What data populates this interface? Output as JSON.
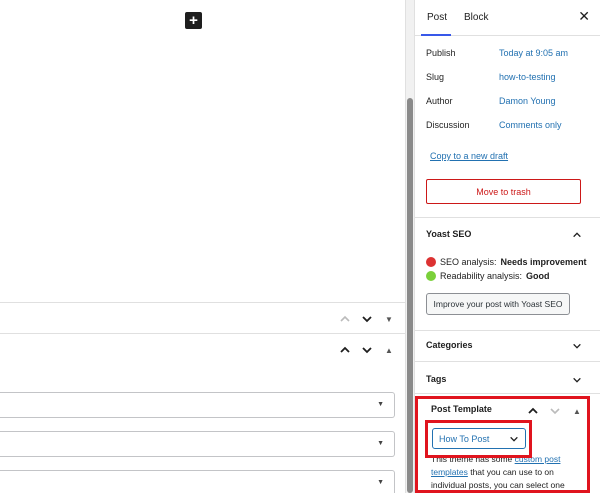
{
  "editor": {
    "add_block_symbol": "+"
  },
  "sidebar": {
    "tabs": [
      {
        "label": "Post",
        "active": true
      },
      {
        "label": "Block",
        "active": false
      }
    ],
    "close_symbol": "✕",
    "fields": [
      {
        "label": "Publish",
        "value": "Today at 9:05 am"
      },
      {
        "label": "Slug",
        "value": "how-to-testing"
      },
      {
        "label": "Author",
        "value": "Damon Young"
      },
      {
        "label": "Discussion",
        "value": "Comments only"
      }
    ],
    "copy_link": "Copy to a new draft",
    "trash_label": "Move to trash",
    "yoast": {
      "title": "Yoast SEO",
      "seo_label": "SEO analysis:",
      "seo_value": "Needs improvement",
      "read_label": "Readability analysis:",
      "read_value": "Good",
      "button": "Improve your post with Yoast SEO"
    },
    "categories_title": "Categories",
    "tags_title": "Tags",
    "post_template": {
      "title": "Post Template",
      "selected": "How To Post",
      "desc_pre": "This theme has some ",
      "desc_link": "custom post templates",
      "desc_post": " that you can use to on individual posts, you can select one"
    }
  },
  "colors": {
    "accent": "#2271b1",
    "danger": "#cc1818",
    "highlight": "#e0141e"
  }
}
